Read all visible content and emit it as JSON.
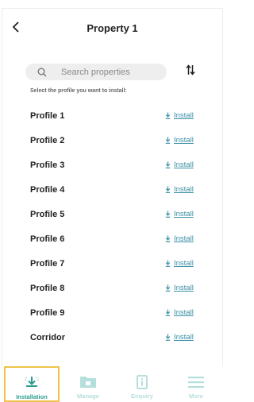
{
  "header": {
    "title": "Property 1"
  },
  "search": {
    "placeholder": "Search properties"
  },
  "hint": "Select the profile you want to install:",
  "profiles": [
    {
      "name": "Profile 1",
      "action": "Install"
    },
    {
      "name": "Profile 2",
      "action": "Install"
    },
    {
      "name": "Profile 3",
      "action": "Install"
    },
    {
      "name": "Profile 4",
      "action": "Install"
    },
    {
      "name": "Profile 5",
      "action": "Install"
    },
    {
      "name": "Profile 6",
      "action": "Install"
    },
    {
      "name": "Profile 7",
      "action": "Install"
    },
    {
      "name": "Profile 8",
      "action": "Install"
    },
    {
      "name": "Profile 9",
      "action": "Install"
    },
    {
      "name": "Corridor",
      "action": "Install"
    }
  ],
  "tabs": [
    {
      "label": "Installation",
      "icon": "download-icon",
      "active": true
    },
    {
      "label": "Manage",
      "icon": "folder-icon",
      "active": false
    },
    {
      "label": "Enquiry",
      "icon": "info-icon",
      "active": false
    },
    {
      "label": "More",
      "icon": "menu-icon",
      "active": false
    }
  ],
  "colors": {
    "accent": "#2a9d8f",
    "link": "#3a8fa5",
    "inactive_tab": "#b5dfdb",
    "active_outline": "#f0c24a"
  }
}
